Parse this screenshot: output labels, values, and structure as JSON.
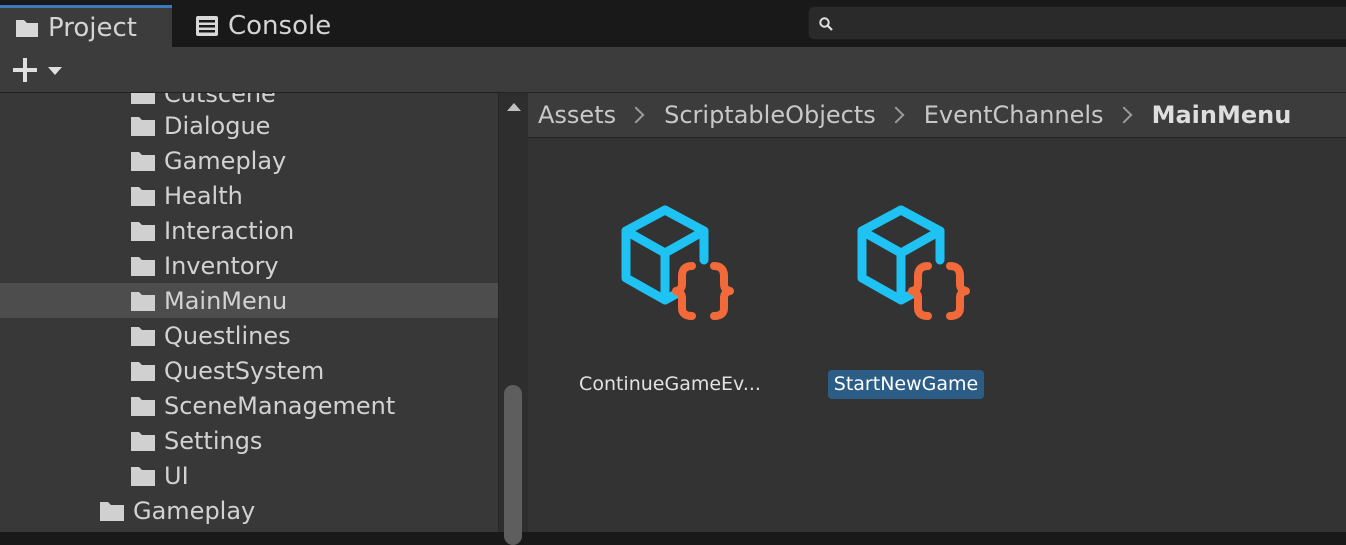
{
  "tabs": [
    {
      "label": "Project",
      "icon": "folder-icon",
      "active": true
    },
    {
      "label": "Console",
      "icon": "console-icon",
      "active": false
    }
  ],
  "toolbar": {
    "create_icon": "plus-icon",
    "dropdown_icon": "triangle-down-icon",
    "search_value": "",
    "search_icon": "search-icon"
  },
  "tree": {
    "items": [
      {
        "label": "Cutscene"
      },
      {
        "label": "Dialogue"
      },
      {
        "label": "Gameplay"
      },
      {
        "label": "Health"
      },
      {
        "label": "Interaction"
      },
      {
        "label": "Inventory"
      },
      {
        "label": "MainMenu",
        "selected": true
      },
      {
        "label": "Questlines"
      },
      {
        "label": "QuestSystem"
      },
      {
        "label": "SceneManagement"
      },
      {
        "label": "Settings"
      },
      {
        "label": "UI"
      },
      {
        "label": "Gameplay"
      }
    ]
  },
  "breadcrumb": {
    "items": [
      "Assets",
      "ScriptableObjects",
      "EventChannels",
      "MainMenu"
    ]
  },
  "assets": [
    {
      "label": "ContinueGameEv...",
      "icon": "scriptable-object-icon",
      "selected": false
    },
    {
      "label": "StartNewGame",
      "icon": "scriptable-object-icon",
      "selected": true
    }
  ],
  "colors": {
    "cube": "#1fc3f3",
    "braces": "#f26a3a",
    "selection": "#2c5d87",
    "tab_accent": "#3a79bb"
  }
}
